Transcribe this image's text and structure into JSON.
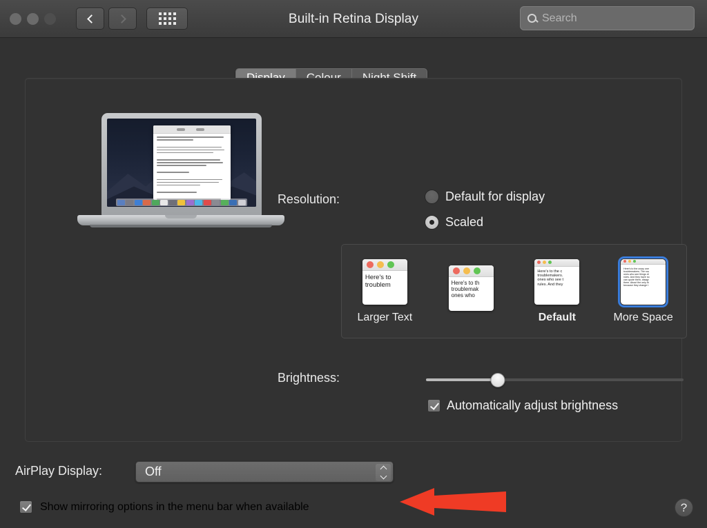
{
  "window": {
    "title": "Built-in Retina Display",
    "traffic_lights": [
      "close",
      "minimize",
      "zoom"
    ],
    "back_label": "Back",
    "forward_label": "Forward",
    "grid_label": "Show All"
  },
  "search": {
    "placeholder": "Search",
    "value": "",
    "icon": "search-icon"
  },
  "tabs": [
    {
      "label": "Display",
      "active": true
    },
    {
      "label": "Colour",
      "active": false
    },
    {
      "label": "Night Shift",
      "active": false
    }
  ],
  "resolution": {
    "label": "Resolution:",
    "options": [
      {
        "label": "Default for display",
        "selected": false
      },
      {
        "label": "Scaled",
        "selected": true
      }
    ],
    "scaled_choices": [
      {
        "caption": "Larger Text",
        "selected": false,
        "bold": false,
        "text_size": "sz-lg",
        "lines": [
          "Here's to",
          "troublem"
        ]
      },
      {
        "caption": "",
        "selected": false,
        "bold": false,
        "text_size": "sz-md",
        "lines": [
          "Here's to th",
          "troublemak",
          "ones who "
        ]
      },
      {
        "caption": "Default",
        "selected": false,
        "bold": true,
        "text_size": "sz-sm",
        "lines": [
          "Here's to the c",
          "troublemakers.",
          "ones who see t",
          "rules. And they"
        ]
      },
      {
        "caption": "More Space",
        "selected": true,
        "bold": false,
        "text_size": "sz-xs",
        "lines": [
          "Here's to the crazy one",
          "troublemakers. The rou",
          "ones who see things di",
          "rules. And they have no",
          "can quote them, disagr",
          "them. About the only th",
          "because they change t"
        ]
      }
    ]
  },
  "brightness": {
    "label": "Brightness:",
    "value_percent": 28,
    "auto_adjust": {
      "label": "Automatically adjust brightness",
      "checked": true
    }
  },
  "airplay": {
    "label": "AirPlay Display:",
    "value": "Off",
    "options": [
      "Off"
    ]
  },
  "mirroring": {
    "label": "Show mirroring options in the menu bar when available",
    "checked": true
  },
  "help": {
    "label": "?"
  },
  "annotation": {
    "arrow_color": "#ef3b25",
    "points_to": "mirroring-checkbox"
  },
  "colors": {
    "window_bg": "#323232",
    "titlebar": "#464646",
    "accent_blue": "#3a7ddc",
    "text": "#f0f0f0"
  }
}
